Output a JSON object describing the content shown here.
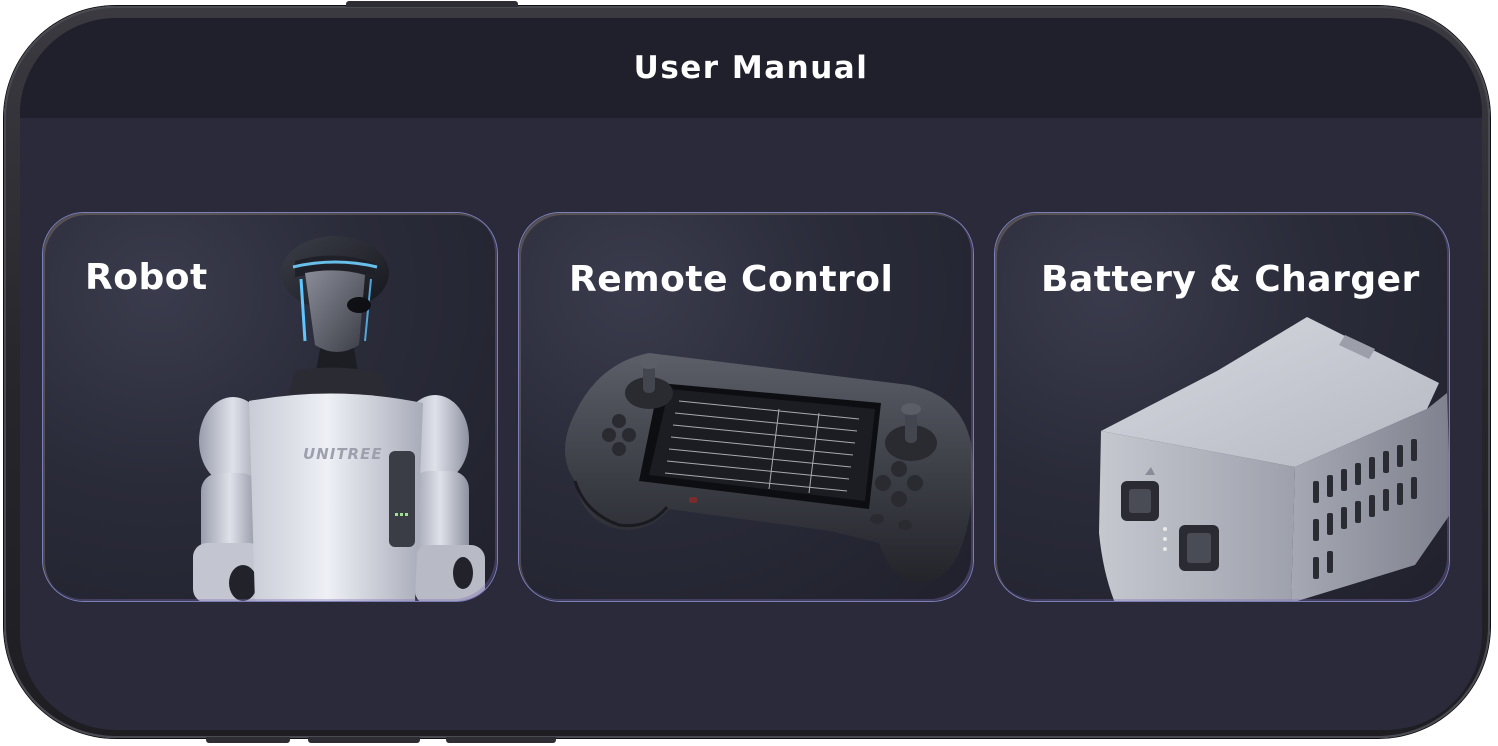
{
  "header": {
    "title": "User Manual"
  },
  "cards": [
    {
      "label": "Robot",
      "image": "humanoid-robot-image"
    },
    {
      "label": "Remote Control",
      "image": "remote-control-image"
    },
    {
      "label": "Battery & Charger",
      "image": "battery-charger-image"
    }
  ],
  "robot_logo": "UNITREE",
  "colors": {
    "screen_bg": "#2a2a3a",
    "header_bg": "#20202c",
    "card_border": "#7a7fb8",
    "text": "#ffffff"
  }
}
